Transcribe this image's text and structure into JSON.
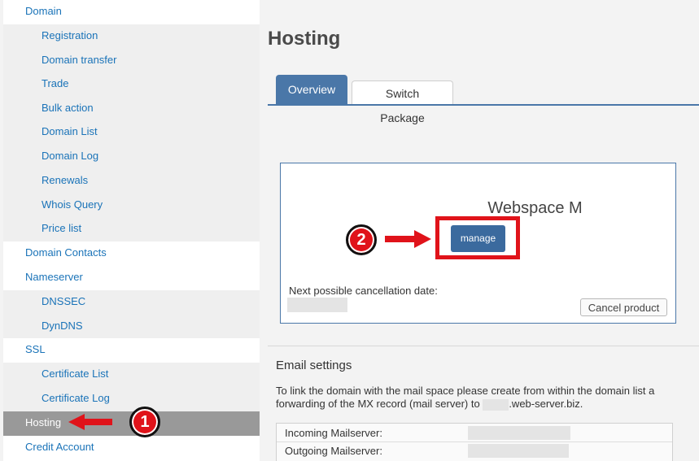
{
  "sidebar": {
    "items": [
      {
        "label": "Domain",
        "level": "top"
      },
      {
        "label": "Registration",
        "level": "sub"
      },
      {
        "label": "Domain transfer",
        "level": "sub"
      },
      {
        "label": "Trade",
        "level": "sub"
      },
      {
        "label": "Bulk action",
        "level": "sub"
      },
      {
        "label": "Domain List",
        "level": "sub"
      },
      {
        "label": "Domain Log",
        "level": "sub"
      },
      {
        "label": "Renewals",
        "level": "sub"
      },
      {
        "label": "Whois Query",
        "level": "sub"
      },
      {
        "label": "Price list",
        "level": "sub"
      },
      {
        "label": "Domain Contacts",
        "level": "top"
      },
      {
        "label": "Nameserver",
        "level": "top"
      },
      {
        "label": "DNSSEC",
        "level": "sub"
      },
      {
        "label": "DynDNS",
        "level": "sub"
      },
      {
        "label": "SSL",
        "level": "top"
      },
      {
        "label": "Certificate List",
        "level": "sub"
      },
      {
        "label": "Certificate Log",
        "level": "sub"
      },
      {
        "label": "Hosting",
        "level": "top",
        "active": true
      },
      {
        "label": "Credit Account",
        "level": "top"
      }
    ]
  },
  "main": {
    "title": "Hosting",
    "tabs": [
      {
        "label": "Overview",
        "active": true
      },
      {
        "label": "Switch Package",
        "active": false
      }
    ],
    "product": {
      "name": "Webspace M",
      "manage_label": "manage",
      "cancellation_label": "Next possible cancellation date:",
      "cancel_button": "Cancel product"
    },
    "email": {
      "title": "Email settings",
      "desc_part1": "To link the domain with the mail space please create from within the domain list a forwarding of the MX record (mail server) to ",
      "desc_part2": ".web-server.biz.",
      "incoming_label": "Incoming Mailserver:",
      "outgoing_label": "Outgoing Mailserver:"
    }
  },
  "annotations": {
    "badge_1": "1",
    "badge_2": "2",
    "color": "#e0131a"
  },
  "colors": {
    "link": "#1a73b8",
    "accent": "#4a77a8",
    "active_sidebar": "#999999"
  }
}
